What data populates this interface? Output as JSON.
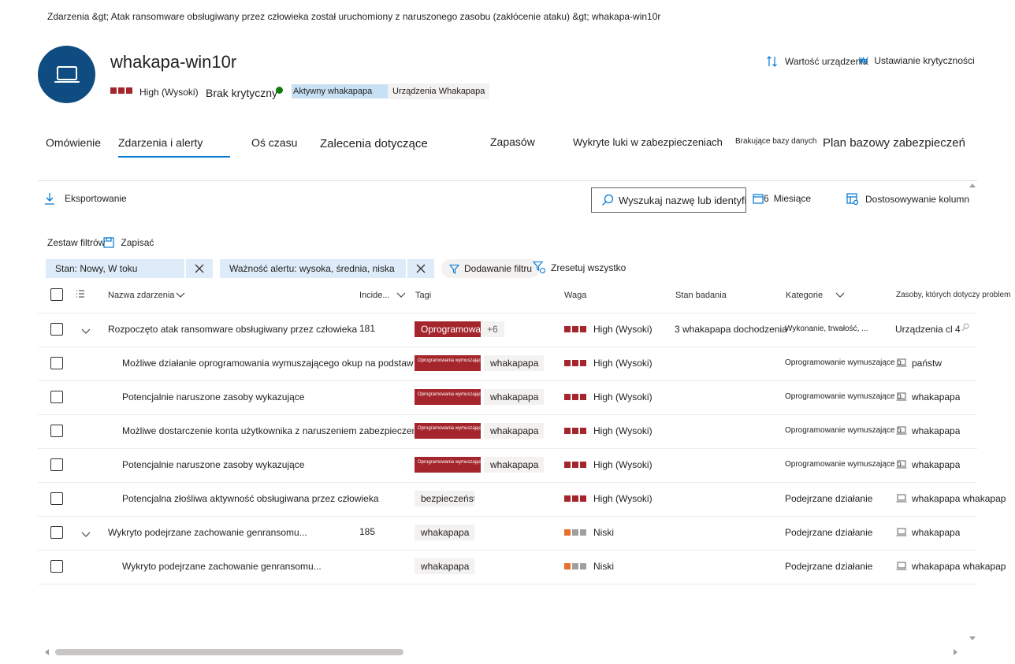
{
  "breadcrumb": "Zdarzenia &gt;  Atak ransomware obsługiwany przez człowieka został uruchomiony z naruszonego zasobu (zakłócenie ataku) &gt; whakapa-win10r",
  "device": {
    "name": "whakapa-win10r",
    "icon": "laptop-icon",
    "severity": "High (Wysoki)",
    "criticality": "Brak krytyczny",
    "status_tag": "Aktywny whakapapa",
    "group_tag": "Urządzenia Whakapapa"
  },
  "header_actions": {
    "device_value": "Wartość urządzenia",
    "set_criticality": "Ustawianie krytyczności"
  },
  "tabs": [
    {
      "label": "Omówienie"
    },
    {
      "label": "Zdarzenia i alerty"
    },
    {
      "label": "Oś czasu"
    },
    {
      "label": "Zalecenia dotyczące"
    },
    {
      "label": "Zapasów"
    },
    {
      "label": "Wykryte luki w zabezpieczeniach"
    },
    {
      "label": "Brakujące bazy danych"
    },
    {
      "label": "Plan bazowy zabezpieczeń"
    }
  ],
  "toolbar": {
    "export": "Eksportowanie",
    "search_placeholder": "Wyszukaj nazwę lub identyfikator",
    "period_num": "6",
    "period": "Miesiące",
    "customize_columns": "Dostosowywanie kolumn"
  },
  "filters": {
    "filter_set": "Zestaw filtrów",
    "save": "Zapisać",
    "chip1": "Stan: Nowy, W toku",
    "chip2": "Ważność alertu: wysoka, średnia, niska",
    "add_filter": "Dodawanie filtru",
    "reset_all": "Zresetuj wszystko"
  },
  "columns": {
    "name": "Nazwa zdarzenia",
    "incident": "Incide...",
    "tags": "Tagi",
    "severity": "Waga",
    "investigation": "Stan badania",
    "category": "Kategorie",
    "assets": "Zasoby, których dotyczy problem"
  },
  "rows": [
    {
      "name": "Rozpoczęto atak ransomware obsługiwany przez człowieka",
      "id": "181",
      "tag": "Oprogramowanie",
      "tag_style": "red-big",
      "extra": "+6",
      "severity": "High (Wysoki)",
      "level": "high",
      "investigation": "3 whakapapa dochodzenia",
      "category": "Wykonanie, trwałość, ...",
      "asset": "Urządzenia cl 4"
    },
    {
      "name": "Możliwe działanie oprogramowania wymuszającego okup na podstawie wiedzy",
      "tag": "Oprogramowania wymuszające okup",
      "tag_style": "red-tiny",
      "tag2": "whakapapa",
      "severity": "High (Wysoki)",
      "level": "high",
      "category": "Oprogramowanie wymuszające okup",
      "asset": "państw"
    },
    {
      "name": "Potencjalnie naruszone zasoby wykazujące",
      "tag": "Oprogramowania wymuszające okup",
      "tag_style": "red-tiny",
      "tag2": "whakapapa",
      "severity": "High (Wysoki)",
      "level": "high",
      "category": "Oprogramowanie wymuszające okup.",
      "asset": "whakapapa"
    },
    {
      "name": "Możliwe dostarczenie konta użytkownika z naruszeniem zabezpieczeń",
      "tag": "Oprogramowania wymuszające okup",
      "tag_style": "red-tiny",
      "tag2": "whakapapa",
      "severity": "High (Wysoki)",
      "level": "high",
      "category": "Oprogramowanie wymuszające okup.",
      "asset": "whakapapa"
    },
    {
      "name": "Potencjalnie naruszone zasoby wykazujące",
      "tag": "Oprogramowania wymuszające okup",
      "tag_style": "red-tiny",
      "tag2": "whakapapa",
      "severity": "High (Wysoki)",
      "level": "high",
      "category": "Oprogramowanie wymuszające okup.",
      "asset": "whakapapa"
    },
    {
      "name": "Potencjalna złośliwa aktywność obsługiwana przez człowieka",
      "tag": "bezpieczeństwa",
      "tag_style": "gray",
      "severity": "High (Wysoki)",
      "level": "high",
      "category": "Podejrzane działanie",
      "asset": "whakapapa whakapapa"
    },
    {
      "name": "Wykryto podejrzane zachowanie genransomu...",
      "id": "185",
      "tag": "whakapapa",
      "tag_style": "gray",
      "severity": "Niski",
      "level": "low",
      "category": "Podejrzane działanie",
      "asset": "whakapapa"
    },
    {
      "name": "Wykryto podejrzane zachowanie genransomu...",
      "tag": "whakapapa",
      "tag_style": "gray",
      "severity": "Niski",
      "level": "low",
      "category": "Podejrzane działanie",
      "asset": "whakapapa whakapapa"
    }
  ],
  "colors": {
    "accent": "#0078d4",
    "avatar": "#0f4c81",
    "high": "#a4262c",
    "low": "#e8702a",
    "low_rest": "#a19f9d",
    "active_dot": "#107c10"
  }
}
